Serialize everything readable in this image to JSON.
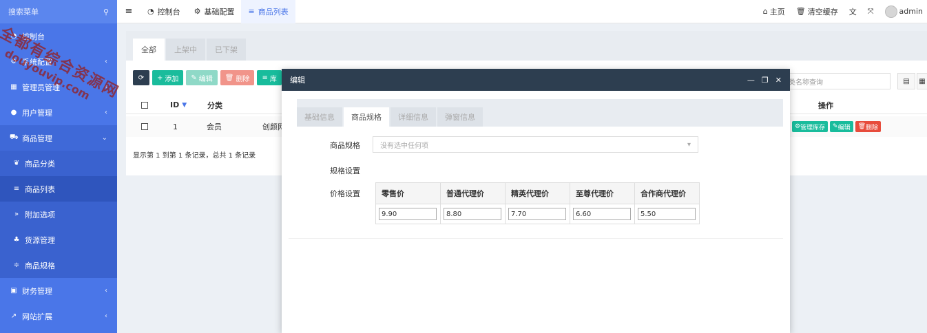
{
  "sidebar": {
    "search_label": "搜索菜单",
    "items": [
      {
        "icon": "dashboard-icon",
        "label": "控制台"
      },
      {
        "icon": "gears-icon",
        "label": "系统配置"
      },
      {
        "icon": "windows-icon",
        "label": "管理员管理"
      },
      {
        "icon": "user-icon",
        "label": "用户管理"
      },
      {
        "icon": "cart-icon",
        "label": "商品管理"
      },
      {
        "icon": "leaf-icon",
        "label": "商品分类"
      },
      {
        "icon": "list-icon",
        "label": "商品列表"
      },
      {
        "icon": "angle-double-icon",
        "label": "附加选项"
      },
      {
        "icon": "sitemap-icon",
        "label": "货源管理"
      },
      {
        "icon": "sliders-icon",
        "label": "商品规格"
      },
      {
        "icon": "calculator-icon",
        "label": "财务管理"
      },
      {
        "icon": "external-link-icon",
        "label": "网站扩展"
      }
    ]
  },
  "header": {
    "tabs": [
      "控制台",
      "基础配置",
      "商品列表"
    ],
    "right": {
      "home": "主页",
      "clear_cache": "清空缓存",
      "user": "admin"
    }
  },
  "content": {
    "tabs": [
      "全部",
      "上架中",
      "已下架"
    ],
    "toolbar": {
      "add": "添加",
      "edit": "编辑",
      "delete": "删除",
      "stock": "库"
    },
    "search_placeholder": "类名称查询",
    "columns": {
      "id": "ID",
      "category": "分类",
      "actions": "操作"
    },
    "row": {
      "id": "1",
      "category": "会员",
      "name": "创颜网"
    },
    "row_buttons": {
      "stock": "管理库存",
      "edit": "编辑",
      "delete": "删除"
    },
    "summary": "显示第 1 到第 1 条记录，总共 1 条记录"
  },
  "modal": {
    "title": "编辑",
    "tabs": [
      "基础信息",
      "商品规格",
      "详细信息",
      "弹窗信息"
    ],
    "spec_label": "商品规格",
    "spec_placeholder": "没有选中任何项",
    "spec_settings_label": "规格设置",
    "price_label": "价格设置",
    "price_headers": [
      "零售价",
      "普通代理价",
      "精英代理价",
      "至尊代理价",
      "合作商代理价"
    ],
    "price_values": [
      "9.90",
      "8.80",
      "7.70",
      "6.60",
      "5.50"
    ]
  },
  "watermark": {
    "line1": "全都有综合资源网",
    "line2": "douyouvip.com"
  },
  "colors": {
    "sidebar": "#4a76e8",
    "modal_header": "#2d3e50",
    "green": "#1abc9c",
    "danger": "#e74c3c"
  }
}
